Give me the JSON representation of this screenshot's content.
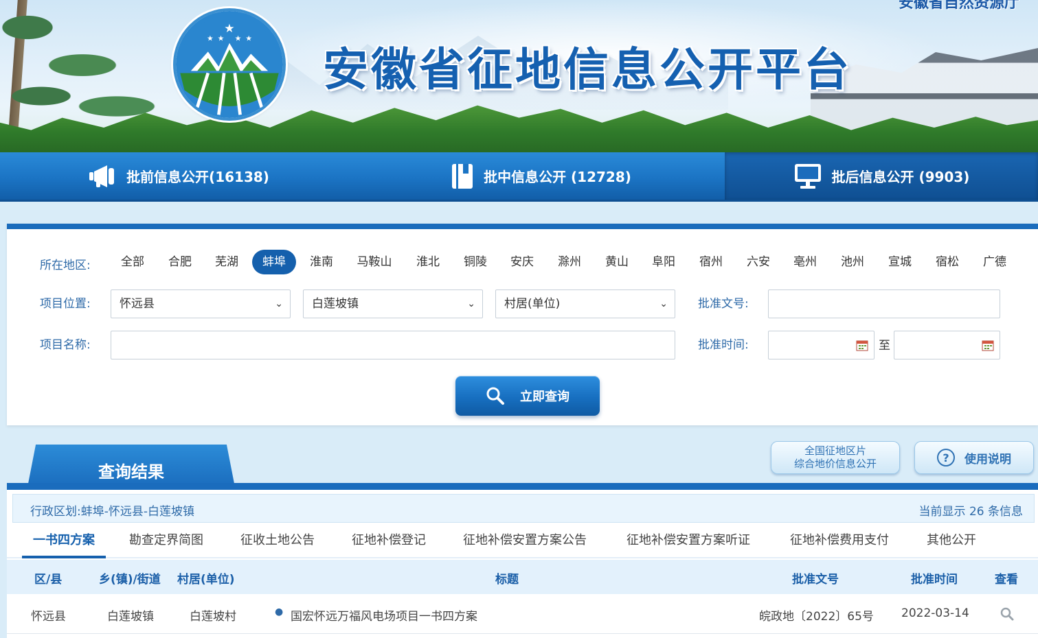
{
  "header": {
    "site_title": "安徽省征地信息公开平台",
    "department": "安徽省自然资源厅"
  },
  "nav": {
    "items": [
      {
        "label": "批前信息公开(16138)",
        "icon": "megaphone-icon"
      },
      {
        "label": "批中信息公开 (12728)",
        "icon": "book-icon"
      },
      {
        "label": "批后信息公开 (9903)",
        "icon": "monitor-icon",
        "active": true
      }
    ]
  },
  "search": {
    "region_label": "所在地区:",
    "regions": [
      "全部",
      "合肥",
      "芜湖",
      "蚌埠",
      "淮南",
      "马鞍山",
      "淮北",
      "铜陵",
      "安庆",
      "滁州",
      "黄山",
      "阜阳",
      "宿州",
      "六安",
      "亳州",
      "池州",
      "宣城",
      "宿松",
      "广德"
    ],
    "active_region": "蚌埠",
    "location_label": "项目位置:",
    "county_value": "怀远县",
    "town_value": "白莲坡镇",
    "village_placeholder": "村居(单位)",
    "approval_no_label": "批准文号:",
    "project_name_label": "项目名称:",
    "approval_time_label": "批准时间:",
    "to_label": "至",
    "query_button": "立即查询"
  },
  "results": {
    "tab_title": "查询结果",
    "national_btn_line1": "全国征地区片",
    "national_btn_line2": "综合地价信息公开",
    "help_btn": "使用说明",
    "admin_division": "行政区划:蚌埠-怀远县-白莲坡镇",
    "count_text": "当前显示 26 条信息",
    "tabs": [
      "一书四方案",
      "勘查定界简图",
      "征收土地公告",
      "征地补偿登记",
      "征地补偿安置方案公告",
      "征地补偿安置方案听证",
      "征地补偿费用支付",
      "其他公开"
    ],
    "active_tab": "一书四方案",
    "columns": {
      "county": "区/县",
      "town": "乡(镇)/街道",
      "village": "村居(单位)",
      "title": "标题",
      "approval_no": "批准文号",
      "approval_time": "批准时间",
      "view": "查看"
    },
    "rows": [
      {
        "county": "怀远县",
        "town": "白莲坡镇",
        "village": "白莲坡村",
        "title": "国宏怀远万福风电场项目一书四方案",
        "approval_no": "皖政地〔2022〕65号",
        "approval_time": "2022-03-14"
      }
    ]
  },
  "colors": {
    "primary": "#1b6cbc",
    "accent_text": "#2e6aa8",
    "title_blue": "#1560b0"
  }
}
